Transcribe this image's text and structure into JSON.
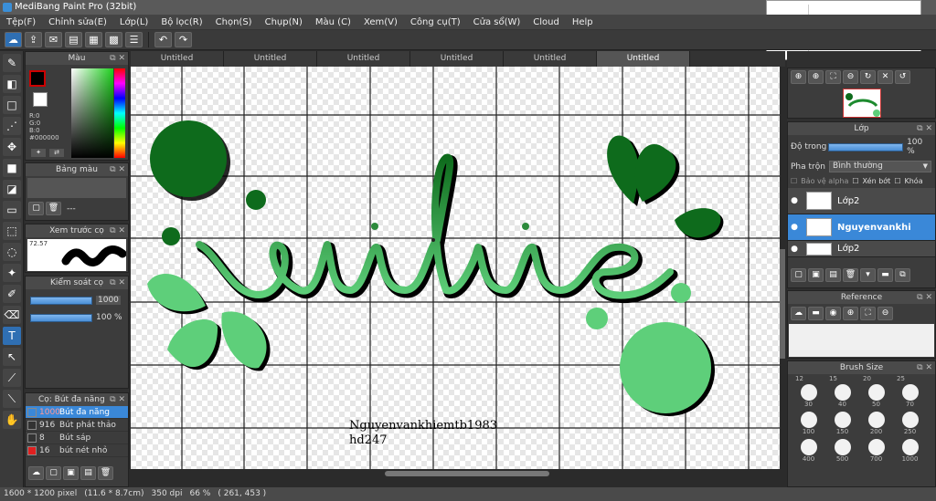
{
  "window": {
    "title": "MediBang Paint Pro (32bit)"
  },
  "menu": [
    "Tệp(F)",
    "Chỉnh sửa(E)",
    "Lớp(L)",
    "Bộ lọc(R)",
    "Chọn(S)",
    "Chụp(N)",
    "Màu (C)",
    "Xem(V)",
    "Công cụ(T)",
    "Cửa sổ(W)",
    "Cloud",
    "Help"
  ],
  "tabs": [
    "Untitled",
    "Untitled",
    "Untitled",
    "Untitled",
    "Untitled",
    "Untitled"
  ],
  "color_panel": {
    "title": "Màu",
    "r": "R:0",
    "g": "G:0",
    "b": "B:0",
    "hex": "#000000"
  },
  "palette_panel": {
    "title": "Bảng màu",
    "dash": "---"
  },
  "preview_panel": {
    "title": "Xem trước cọ",
    "value": "72.57"
  },
  "brush_control": {
    "title": "Kiểm soát cọ",
    "size": "1000",
    "opacity": "100 %"
  },
  "brush_list": {
    "title": "Cọ: Bút đa năng",
    "items": [
      {
        "size": "1000",
        "name": "Bút đa năng"
      },
      {
        "size": "916",
        "name": "Bút phát thảo"
      },
      {
        "size": "8",
        "name": "Bút sáp"
      },
      {
        "size": "16",
        "name": "bút nét nhỏ"
      }
    ]
  },
  "canvas": {
    "word": "vintine",
    "signature_line1": "Nguyenvankhiemtb1983",
    "signature_line2": "hd247",
    "colors": {
      "dark": "#0e6b1c",
      "light": "#5ecf7a"
    }
  },
  "layer_panel": {
    "title": "Lớp",
    "opacity_label": "Độ trong",
    "opacity_value": "100 %",
    "blend_label": "Pha trộn",
    "blend_value": "Bình thường",
    "protect_alpha": "Bảo vệ alpha",
    "clipping": "Xén bớt",
    "lock": "Khóa",
    "layers": [
      {
        "name": "Lớp2"
      },
      {
        "name": "Nguyenvankhi"
      },
      {
        "name": "Lớp2"
      }
    ]
  },
  "reference_panel": {
    "title": "Reference"
  },
  "brush_size_panel": {
    "title": "Brush Size",
    "row_labels": [
      [
        "12",
        "15",
        "20",
        "25"
      ],
      [
        "30",
        "40",
        "50",
        "70"
      ],
      [
        "100",
        "150",
        "200",
        "250"
      ],
      [
        "300",
        "400",
        "500",
        "700"
      ]
    ],
    "bottom_labels": [
      "400",
      "500",
      "700",
      "1000"
    ]
  },
  "status": {
    "size": "1600 * 1200 pixel",
    "cm": "(11.6 * 8.7cm)",
    "dpi": "350 dpi",
    "zoom": "66 %",
    "coords": "( 261, 453 )"
  }
}
